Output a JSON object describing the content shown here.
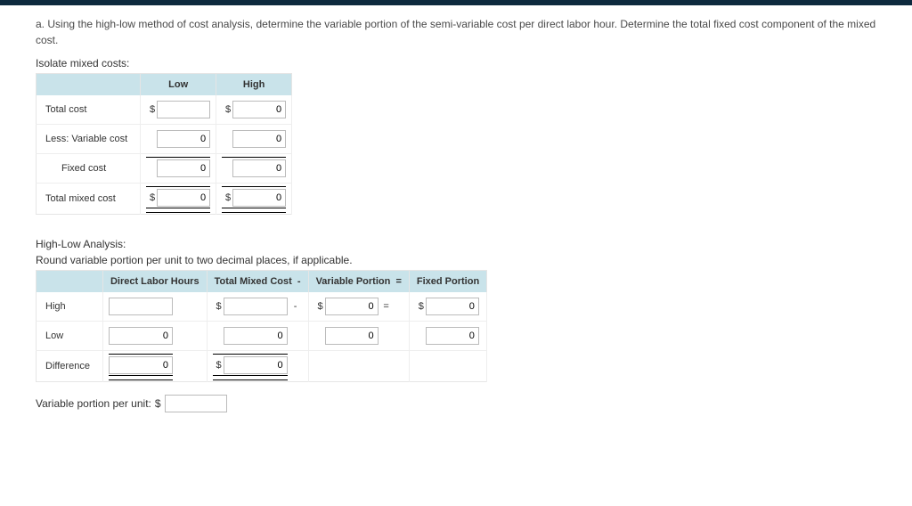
{
  "question": {
    "prefix": "a.",
    "text": "Using the high-low method of cost analysis, determine the variable portion of the semi-variable cost per direct labor hour. Determine the total fixed cost component of the mixed cost."
  },
  "isolate": {
    "heading": "Isolate mixed costs:",
    "cols": {
      "low": "Low",
      "high": "High"
    },
    "rows": {
      "total_cost": "Total cost",
      "less_variable": "Less: Variable cost",
      "fixed_cost": "Fixed cost",
      "total_mixed": "Total mixed cost"
    },
    "values": {
      "total_cost_low": "",
      "total_cost_high": "0",
      "less_variable_low": "0",
      "less_variable_high": "0",
      "fixed_cost_low": "0",
      "fixed_cost_high": "0",
      "total_mixed_low": "0",
      "total_mixed_high": "0"
    }
  },
  "highlow": {
    "heading": "High-Low Analysis:",
    "note": "Round variable portion per unit to two decimal places, if applicable.",
    "cols": {
      "dlh": "Direct Labor Hours",
      "tmc": "Total Mixed Cost",
      "vp": "Variable Portion",
      "fp": "Fixed Portion"
    },
    "ops": {
      "minus": "-",
      "equals": "="
    },
    "rows": {
      "high": "High",
      "low": "Low",
      "diff": "Difference"
    },
    "values": {
      "high_dlh": "",
      "high_tmc": "",
      "high_vp": "0",
      "high_fp": "0",
      "low_dlh": "0",
      "low_tmc": "0",
      "low_vp": "0",
      "low_fp": "0",
      "diff_dlh": "0",
      "diff_tmc": "0"
    }
  },
  "var_per_unit": {
    "label": "Variable portion per unit:",
    "currency": "$",
    "value": ""
  },
  "currency": "$"
}
